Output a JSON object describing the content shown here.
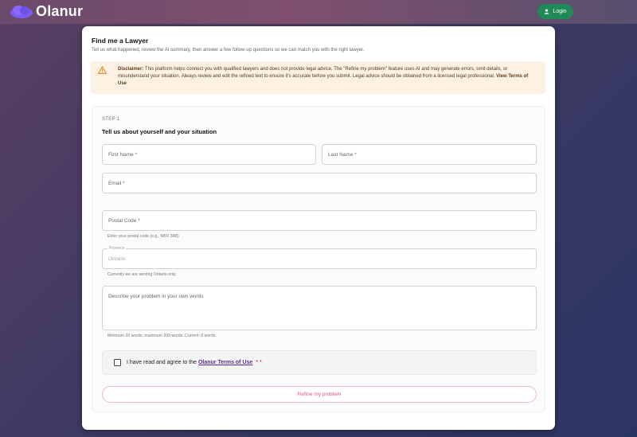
{
  "app": {
    "name": "Olanur"
  },
  "header": {
    "login_label": "Login"
  },
  "page": {
    "title": "Find me a Lawyer",
    "subtitle": "Tell us what happened, review the AI summary, then answer a few follow-up questions so we can match you with the right lawyer."
  },
  "disclaimer": {
    "label": "Disclaimer:",
    "text": "This platform helps connect you with qualified lawyers and does not provide legal advice. The \"Refine my problem\" feature uses AI and may generate errors, omit details, or misunderstand your situation. Always review and edit the refined text to ensure it's accurate before you submit. Legal advice should be obtained from a licensed legal professional.",
    "link": "View Terms of Use"
  },
  "step": {
    "label": "STEP 1",
    "heading": "Tell us about yourself and your situation"
  },
  "form": {
    "first_name": {
      "label": "First Name *",
      "value": ""
    },
    "last_name": {
      "label": "Last Name *",
      "value": ""
    },
    "email": {
      "label": "Email *",
      "value": ""
    },
    "postal_code": {
      "label": "Postal Code *",
      "helper": "Enter your postal code (e.g., M5V 3A8)",
      "value": ""
    },
    "province": {
      "label": "Province",
      "value": "Ontario",
      "helper": "Currently we are serving Ontario only."
    },
    "problem": {
      "placeholder": "Describe your problem in your own words",
      "helper": "Minimum 20 words, maximum 200 words. Current: 0 words."
    },
    "terms": {
      "prefix": "I have read and agree to the",
      "link": "Olanur Terms of Use",
      "required": "* *",
      "checked": false
    },
    "refine_label": "Refine my problem"
  },
  "colors": {
    "accent": "#1f8a57",
    "brand_purple": "#7b5cf0",
    "refine_pink": "#e25579",
    "warning": "#d98c1e"
  },
  "icons": {
    "logo": "cloud-logo-icon",
    "login": "person-icon",
    "warning": "warning-triangle-icon"
  }
}
